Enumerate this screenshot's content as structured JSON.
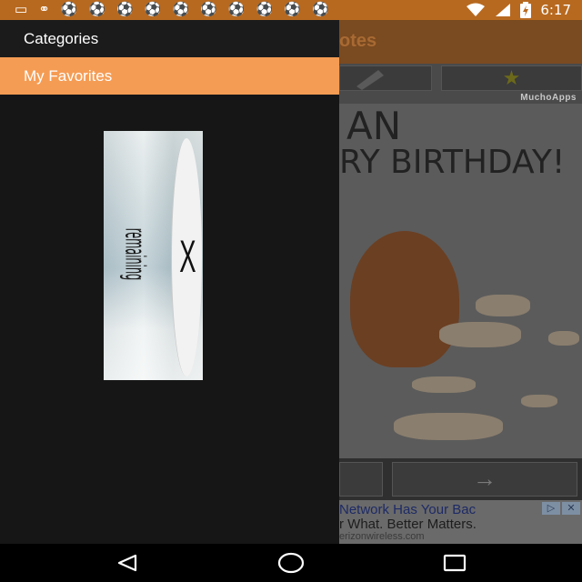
{
  "status_bar": {
    "time": "6:17",
    "left_icons": [
      "message-icon",
      "people-icon",
      "ball-icon",
      "ball-icon",
      "ball-icon",
      "ball-icon",
      "ball-icon",
      "ball-icon",
      "ball-icon",
      "ball-icon",
      "ball-icon",
      "ball-icon"
    ],
    "right_icons": [
      "wifi-icon",
      "signal-icon",
      "battery-charging-icon"
    ]
  },
  "drawer": {
    "items": [
      {
        "label": "Categories",
        "selected": false
      },
      {
        "label": "My Favorites",
        "selected": true
      }
    ],
    "ad": {
      "text": "remaining",
      "close_glyph": "X"
    }
  },
  "background_app": {
    "title": "otes",
    "brand": "MuchoApps",
    "card_line1": "AN",
    "card_line2": "RY BIRTHDAY!",
    "ad_line1": "Network Has Your Bac",
    "ad_line2": "r What. Better Matters.",
    "ad_line3": "erizonwireless.com"
  },
  "colors": {
    "status_bar": "#b7691f",
    "drawer_background": "#161616",
    "selected_item": "#f59c54"
  }
}
